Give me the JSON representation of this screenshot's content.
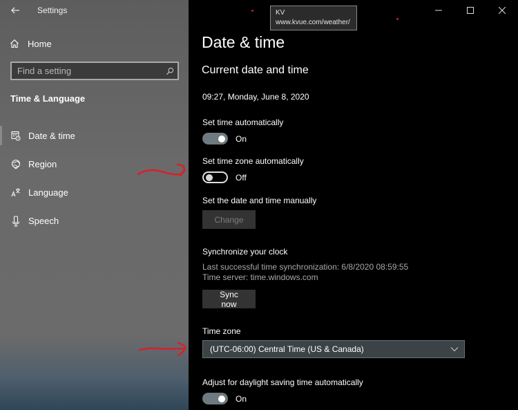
{
  "window": {
    "app_title": "Settings",
    "controls": [
      "minimize",
      "maximize",
      "close"
    ]
  },
  "sidebar": {
    "home_label": "Home",
    "search_placeholder": "Find a setting",
    "section_title": "Time & Language",
    "items": [
      {
        "label": "Date & time",
        "icon": "calendar-clock-icon",
        "active": true
      },
      {
        "label": "Region",
        "icon": "globe-icon",
        "active": false
      },
      {
        "label": "Language",
        "icon": "language-icon",
        "active": false
      },
      {
        "label": "Speech",
        "icon": "microphone-icon",
        "active": false
      }
    ]
  },
  "tooltip": {
    "line1": "KV",
    "line2": "www.kvue.com/weather/"
  },
  "main": {
    "page_title": "Date & time",
    "section_title": "Current date and time",
    "current_datetime": "09:27, Monday, June 8, 2020",
    "set_time_auto": {
      "label": "Set time automatically",
      "state": "On",
      "on": true
    },
    "set_tz_auto": {
      "label": "Set time zone automatically",
      "state": "Off",
      "on": false
    },
    "manual": {
      "label": "Set the date and time manually",
      "button": "Change",
      "disabled": true
    },
    "sync": {
      "label": "Synchronize your clock",
      "last_sync": "Last successful time synchronization: 6/8/2020 08:59:55",
      "server": "Time server: time.windows.com",
      "button": "Sync now"
    },
    "time_zone": {
      "label": "Time zone",
      "selected": "(UTC-06:00) Central Time (US & Canada)"
    },
    "dst": {
      "label": "Adjust for daylight saving time automatically",
      "state": "On",
      "on": true
    }
  },
  "colors": {
    "annotation_red": "#d8202a",
    "toggle_on": "#6e7a80",
    "dropdown_bg": "#3c4346"
  }
}
